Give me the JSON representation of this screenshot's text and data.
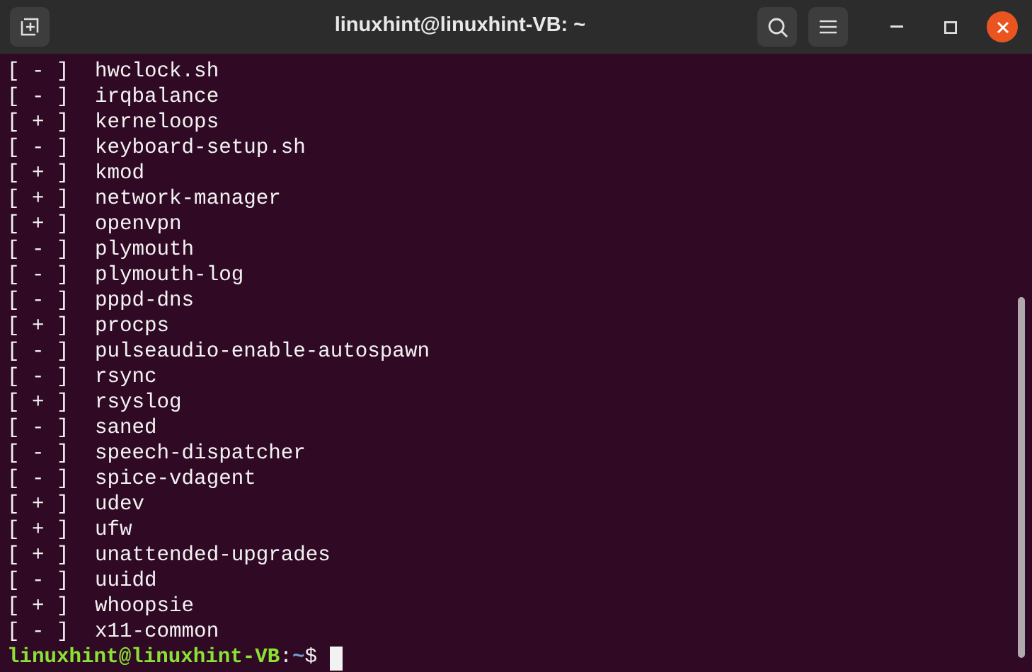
{
  "window": {
    "title": "linuxhint@linuxhint-VB: ~"
  },
  "services": [
    {
      "status": "[ - ]",
      "name": "hwclock.sh"
    },
    {
      "status": "[ - ]",
      "name": "irqbalance"
    },
    {
      "status": "[ + ]",
      "name": "kerneloops"
    },
    {
      "status": "[ - ]",
      "name": "keyboard-setup.sh"
    },
    {
      "status": "[ + ]",
      "name": "kmod"
    },
    {
      "status": "[ + ]",
      "name": "network-manager"
    },
    {
      "status": "[ + ]",
      "name": "openvpn"
    },
    {
      "status": "[ - ]",
      "name": "plymouth"
    },
    {
      "status": "[ - ]",
      "name": "plymouth-log"
    },
    {
      "status": "[ - ]",
      "name": "pppd-dns"
    },
    {
      "status": "[ + ]",
      "name": "procps"
    },
    {
      "status": "[ - ]",
      "name": "pulseaudio-enable-autospawn"
    },
    {
      "status": "[ - ]",
      "name": "rsync"
    },
    {
      "status": "[ + ]",
      "name": "rsyslog"
    },
    {
      "status": "[ - ]",
      "name": "saned"
    },
    {
      "status": "[ - ]",
      "name": "speech-dispatcher"
    },
    {
      "status": "[ - ]",
      "name": "spice-vdagent"
    },
    {
      "status": "[ + ]",
      "name": "udev"
    },
    {
      "status": "[ + ]",
      "name": "ufw"
    },
    {
      "status": "[ + ]",
      "name": "unattended-upgrades"
    },
    {
      "status": "[ - ]",
      "name": "uuidd"
    },
    {
      "status": "[ + ]",
      "name": "whoopsie"
    },
    {
      "status": "[ - ]",
      "name": "x11-common"
    }
  ],
  "prompt": {
    "user_host": "linuxhint@linuxhint-VB",
    "separator": ":",
    "path": "~",
    "symbol": "$"
  }
}
